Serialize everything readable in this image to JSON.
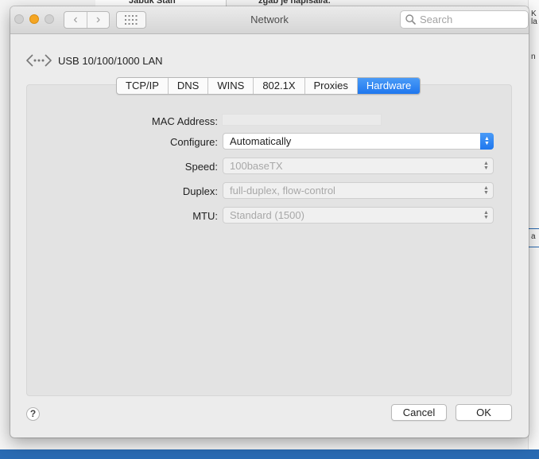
{
  "background": {
    "left_header": "Jabuk Stan",
    "right_header": "zgab je napisal/a:",
    "right_strip_text": [
      "K",
      "la",
      "n",
      "a"
    ]
  },
  "window": {
    "title": "Network",
    "search_placeholder": "Search",
    "nav_back": "‹",
    "nav_forward": "›"
  },
  "interface": {
    "name": "USB 10/100/1000 LAN",
    "icon": "ethernet-dots-icon"
  },
  "tabs": [
    {
      "label": "TCP/IP",
      "active": false
    },
    {
      "label": "DNS",
      "active": false
    },
    {
      "label": "WINS",
      "active": false
    },
    {
      "label": "802.1X",
      "active": false
    },
    {
      "label": "Proxies",
      "active": false
    },
    {
      "label": "Hardware",
      "active": true
    }
  ],
  "form": {
    "mac_label": "MAC Address:",
    "mac_value": "",
    "configure_label": "Configure:",
    "configure_value": "Automatically",
    "speed_label": "Speed:",
    "speed_value": "100baseTX",
    "duplex_label": "Duplex:",
    "duplex_value": "full-duplex, flow-control",
    "mtu_label": "MTU:",
    "mtu_value": "Standard (1500)"
  },
  "buttons": {
    "help": "?",
    "cancel": "Cancel",
    "ok": "OK"
  },
  "colors": {
    "accent": "#1f77ee",
    "minimize": "#f5a623",
    "desktop": "#2a6bb3"
  }
}
